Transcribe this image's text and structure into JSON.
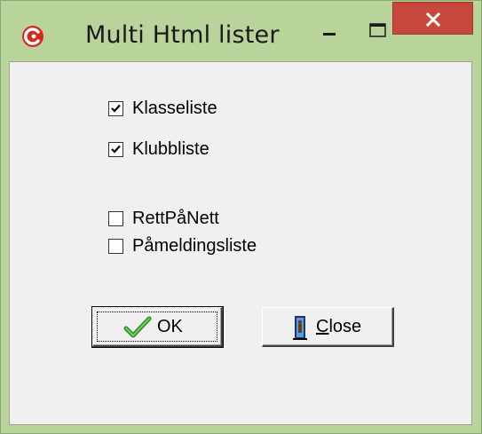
{
  "window": {
    "title": "Multi Html lister",
    "icon": "app-logo-icon",
    "controls": {
      "minimize_glyph": "minimize-icon",
      "maximize_glyph": "maximize-icon",
      "close_glyph": "close-icon"
    }
  },
  "options": {
    "group1": [
      {
        "label": "Klasseliste",
        "checked": true
      },
      {
        "label": "Klubbliste",
        "checked": true
      }
    ],
    "group2": [
      {
        "label": "RettPåNett",
        "checked": false
      },
      {
        "label": "Påmeldingsliste",
        "checked": false
      }
    ]
  },
  "buttons": {
    "ok_label": "OK",
    "ok_icon": "checkmark-icon",
    "close_label_prefix": "C",
    "close_label_rest": "lose",
    "close_icon": "exit-door-icon"
  },
  "colors": {
    "frame": "#b9d49a",
    "close_button": "#c7473c",
    "client_bg": "#f0f0f0",
    "checkmark": "#2e8b2e",
    "app_icon": "#d42a1e"
  }
}
